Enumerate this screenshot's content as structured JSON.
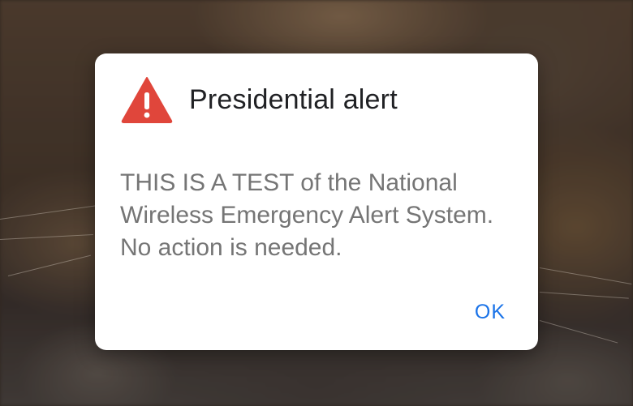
{
  "alert": {
    "title": "Presidential alert",
    "icon": "warning-icon",
    "icon_color": "#e0463b",
    "message": "THIS IS A TEST of the National Wireless Emergency Alert System. No action is needed.",
    "ok_label": "OK",
    "ok_color": "#1a73e8"
  }
}
